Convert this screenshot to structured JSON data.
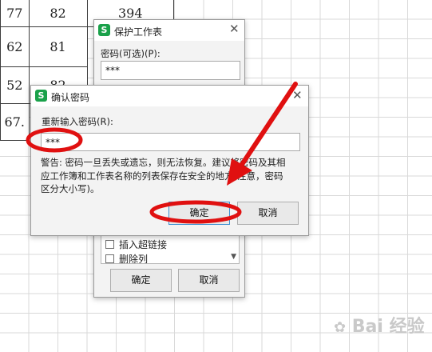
{
  "sheet": {
    "cells": [
      {
        "col": 0,
        "row": 0,
        "text": "77"
      },
      {
        "col": 1,
        "row": 0,
        "text": "82"
      },
      {
        "col": 2,
        "row": 0,
        "text": "394"
      },
      {
        "col": 0,
        "row": 1,
        "text": "62"
      },
      {
        "col": 1,
        "row": 1,
        "text": "81"
      },
      {
        "col": 0,
        "row": 2,
        "text": "52"
      },
      {
        "col": 1,
        "row": 2,
        "text": "82"
      },
      {
        "col": 0,
        "row": 3,
        "text": "67."
      }
    ]
  },
  "protect_dialog": {
    "app_icon": "S",
    "title": "保护工作表",
    "password_label": "密码(可选)(P):",
    "password_value": "***",
    "list_items": [
      "插入超链接",
      "删除列"
    ],
    "ok_label": "确定",
    "cancel_label": "取消"
  },
  "confirm_dialog": {
    "app_icon": "S",
    "title": "确认密码",
    "reenter_label": "重新输入密码(R):",
    "password_value": "***",
    "warning_lines": [
      "警告: 密码一旦丢失或遗忘，则无法恢复。建议将密码及其相",
      "应工作簿和工作表名称的列表保存在安全的地方(注意，密码",
      "区分大小写)。"
    ],
    "ok_label": "确定",
    "cancel_label": "取消"
  },
  "annotation": {
    "color": "#e01010"
  },
  "watermark": {
    "text": "Bai 经验"
  }
}
